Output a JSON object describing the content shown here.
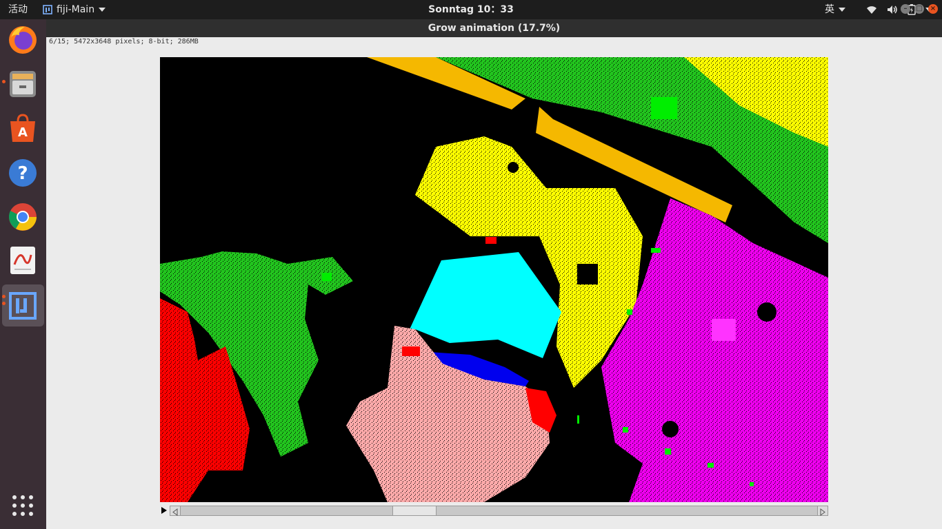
{
  "topbar": {
    "activities": "活动",
    "app_name": "fiji-Main",
    "clock": "Sonntag 10：33",
    "language": "英"
  },
  "window": {
    "title": "Grow animation (17.7%)",
    "info": "6/15; 5472x3648 pixels; 8-bit; 286MB"
  },
  "slice": {
    "current": 6,
    "total": 15
  },
  "dock": {
    "items": [
      "firefox-icon",
      "files-icon",
      "software-center-icon",
      "help-icon",
      "chrome-icon",
      "document-viewer-icon",
      "fiji-icon",
      "show-apps-icon"
    ]
  },
  "colors": {
    "accent": "#e95420",
    "green": "#22c41e",
    "bright_green": "#00ee00",
    "yellow": "#ffff00",
    "orange": "#f5b800",
    "magenta": "#ee00ee",
    "cyan": "#00ffff",
    "red": "#ff0000",
    "pink": "#ffaaaa",
    "blue": "#0000ee"
  }
}
